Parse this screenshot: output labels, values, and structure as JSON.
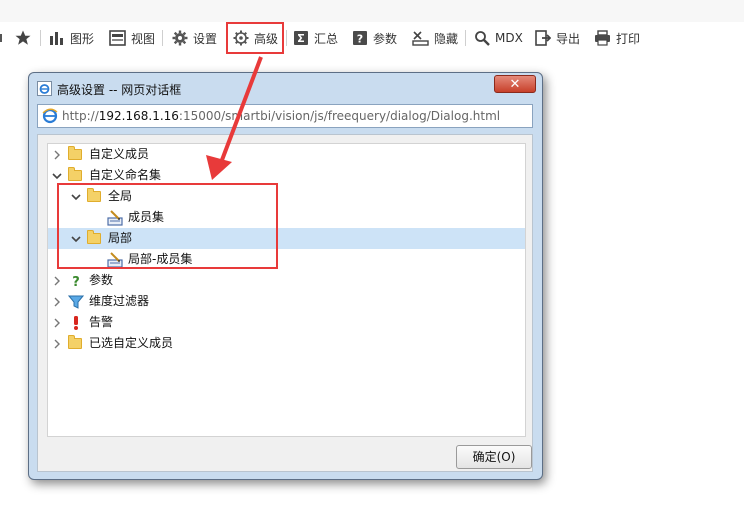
{
  "toolbar": {
    "items": [
      {
        "label": "图形",
        "icon": "bar-chart-icon"
      },
      {
        "label": "视图",
        "icon": "view-icon"
      },
      {
        "label": "设置",
        "icon": "gear-icon"
      },
      {
        "label": "高级",
        "icon": "advanced-gear-icon"
      },
      {
        "label": "汇总",
        "icon": "sigma-icon"
      },
      {
        "label": "参数",
        "icon": "question-icon"
      },
      {
        "label": "隐藏",
        "icon": "hide-icon"
      },
      {
        "label": "MDX",
        "icon": "magnifier-icon"
      },
      {
        "label": "导出",
        "icon": "export-icon"
      },
      {
        "label": "打印",
        "icon": "printer-icon"
      }
    ]
  },
  "dialog": {
    "title": "高级设置 -- 网页对话框",
    "close_label": "✕",
    "address": {
      "prefix": "http://",
      "domain": "192.168.1.16",
      "rest": ":15000/smartbi/vision/js/freequery/dialog/Dialog.html"
    },
    "tree": {
      "items": [
        {
          "label": "自定义成员"
        },
        {
          "label": "自定义命名集"
        },
        {
          "label": "全局"
        },
        {
          "label": "成员集"
        },
        {
          "label": "局部"
        },
        {
          "label": "局部-成员集"
        },
        {
          "label": "参数"
        },
        {
          "label": "维度过滤器"
        },
        {
          "label": "告警"
        },
        {
          "label": "已选自定义成员"
        }
      ]
    },
    "ok_label": "确定(O)"
  },
  "colors": {
    "annotation_red": "#e83a3a",
    "selection": "#cde3f7",
    "folder": "#f4d167"
  }
}
